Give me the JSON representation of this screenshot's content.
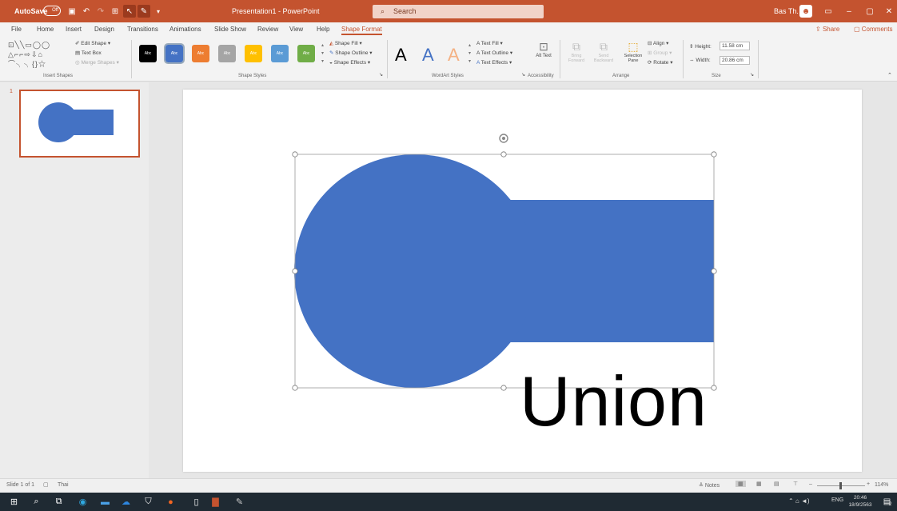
{
  "titlebar": {
    "autosave_label": "AutoSave",
    "autosave_state": "Off",
    "doc_title": "Presentation1 - PowerPoint",
    "search_placeholder": "Search",
    "user_name": "Bas Th."
  },
  "menu": {
    "tabs": [
      "File",
      "Home",
      "Insert",
      "Design",
      "Transitions",
      "Animations",
      "Slide Show",
      "Review",
      "View",
      "Help",
      "Shape Format"
    ],
    "share_label": "Share",
    "comments_label": "Comments"
  },
  "ribbon": {
    "insert_shapes": {
      "edit_shape": "Edit Shape",
      "text_box": "Text Box",
      "merge_shapes": "Merge Shapes",
      "group_label": "Insert Shapes"
    },
    "shape_styles": {
      "swatch_label": "Abc",
      "swatch_colors": [
        "#000000",
        "#4472c4",
        "#ed7d31",
        "#a5a5a5",
        "#ffc000",
        "#5b9bd5",
        "#70ad47"
      ],
      "fill": "Shape Fill",
      "outline": "Shape Outline",
      "effects": "Shape Effects",
      "group_label": "Shape Styles"
    },
    "wordart": {
      "letter": "A",
      "text_fill": "Text Fill",
      "text_outline": "Text Outline",
      "text_effects": "Text Effects",
      "group_label": "WordArt Styles"
    },
    "accessibility": {
      "alt_text": "Alt Text",
      "group_label": "Accessibility"
    },
    "arrange": {
      "bring_forward": "Bring Forward",
      "send_backward": "Send Backward",
      "selection_pane": "Selection Pane",
      "align": "Align",
      "group": "Group",
      "rotate": "Rotate",
      "group_label": "Arrange"
    },
    "size": {
      "height_label": "Height:",
      "height_value": "11.58 cm",
      "width_label": "Width:",
      "width_value": "20.86 cm",
      "group_label": "Size"
    }
  },
  "slides_pane": {
    "slide_number": "1"
  },
  "slide": {
    "caption": "Union",
    "shape_color": "#4472c4"
  },
  "status": {
    "slide_info": "Slide 1 of 1",
    "language": "Thai",
    "notes_label": "Notes",
    "zoom": "114%"
  },
  "taskbar": {
    "language": "ENG",
    "time": "20:46",
    "date": "18/9/2563",
    "notification_count": "2"
  }
}
